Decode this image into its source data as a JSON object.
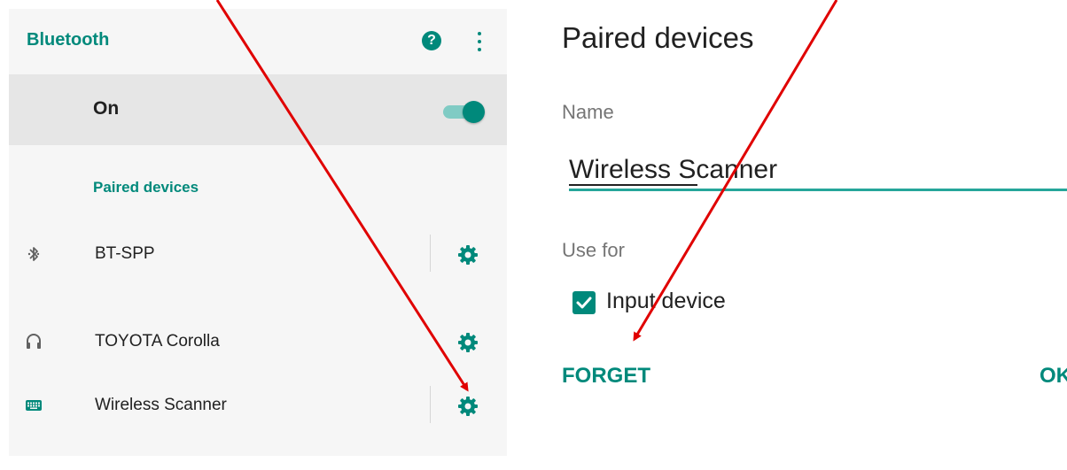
{
  "bluetooth_screen": {
    "title": "Bluetooth",
    "toolbar_icons": [
      "help-icon",
      "more-vert-icon"
    ],
    "master_switch": {
      "label": "On",
      "checked": true
    },
    "paired_header": "Paired devices",
    "devices": [
      {
        "name": "BT-SPP",
        "icon": "bluetooth-icon"
      },
      {
        "name": "TOYOTA Corolla",
        "icon": "headset-icon"
      },
      {
        "name": "Wireless Scanner",
        "icon": "keyboard-icon"
      }
    ]
  },
  "dialog": {
    "title": "Paired devices",
    "name_label": "Name",
    "name_value": "Wireless Scanner",
    "use_for_label": "Use for",
    "input_device": {
      "label": "Input device",
      "checked": true
    },
    "forget_label": "FORGET",
    "ok_label": "OK"
  },
  "colors": {
    "accent": "#00897b",
    "accent_light": "#80cbc4",
    "annotation_arrow": "#e00000"
  }
}
